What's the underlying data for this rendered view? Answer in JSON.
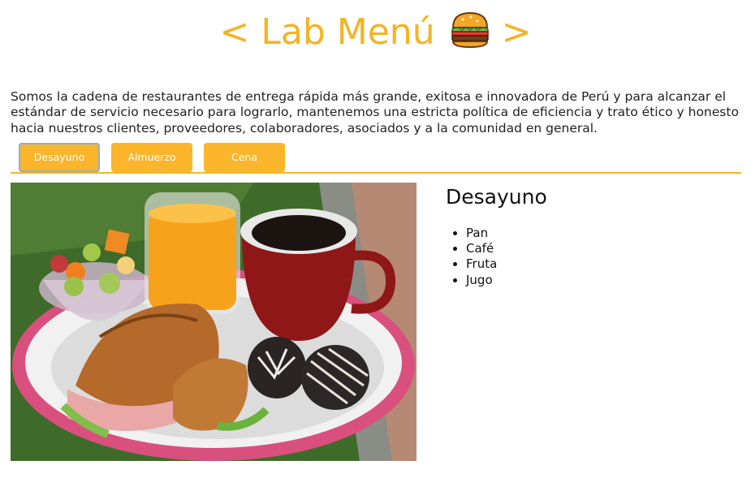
{
  "header": {
    "title": "< Lab Menú",
    "title_suffix": ">",
    "emoji_icon": "hamburger-icon"
  },
  "intro": "Somos la cadena de restaurantes de entrega rápida más grande, exitosa e innovadora de Perú y para alcanzar el estándar de servicio necesario para lograrlo, mantenemos una estricta política de eficiencia y trato ético y honesto hacia nuestros clientes, proveedores, colaboradores, asociados y a la comunidad en general.",
  "tabs": [
    {
      "label": "Desayuno",
      "active": true
    },
    {
      "label": "Almuerzo",
      "active": false
    },
    {
      "label": "Cena",
      "active": false
    }
  ],
  "panel": {
    "title": "Desayuno",
    "items": [
      "Pan",
      "Café",
      "Fruta",
      "Jugo"
    ]
  },
  "colors": {
    "accent": "#f5b324",
    "tab_bg": "#fbb52b",
    "divider": "#f0b72e"
  }
}
